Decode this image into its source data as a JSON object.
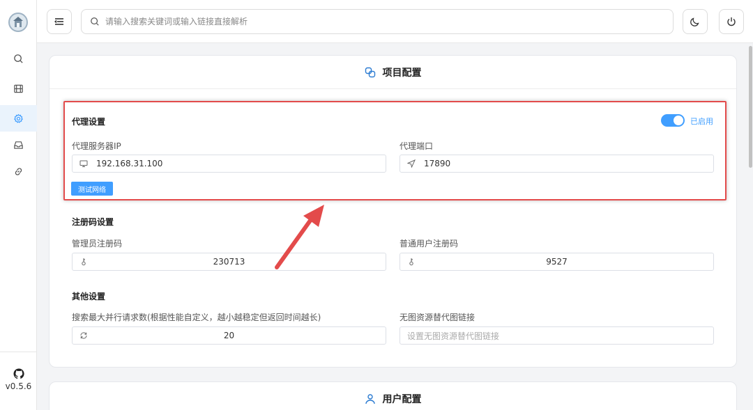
{
  "sidebar": {
    "items": [
      {
        "icon": "search-icon"
      },
      {
        "icon": "film-icon"
      },
      {
        "icon": "gear-icon",
        "active": true
      },
      {
        "icon": "inbox-icon"
      },
      {
        "icon": "link-icon"
      }
    ],
    "version": "v0.5.6"
  },
  "header": {
    "search_placeholder": "请输入搜索关键词或输入链接直接解析"
  },
  "project_config": {
    "title": "项目配置",
    "proxy": {
      "title": "代理设置",
      "enabled_label": "已启用",
      "enabled": true,
      "ip_label": "代理服务器IP",
      "ip_value": "192.168.31.100",
      "port_label": "代理端口",
      "port_value": "17890",
      "test_button": "测试网络"
    },
    "register": {
      "title": "注册码设置",
      "admin_label": "管理员注册码",
      "admin_value": "230713",
      "user_label": "普通用户注册码",
      "user_value": "9527"
    },
    "other": {
      "title": "其他设置",
      "max_requests_label": "搜索最大并行请求数(根据性能自定义，越小越稳定但返回时间越长)",
      "max_requests_value": "20",
      "no_image_label": "无图资源替代图链接",
      "no_image_placeholder": "设置无图资源替代图链接"
    }
  },
  "user_config": {
    "title": "用户配置"
  },
  "colors": {
    "accent": "#409eff",
    "highlight": "#e34b4b"
  }
}
